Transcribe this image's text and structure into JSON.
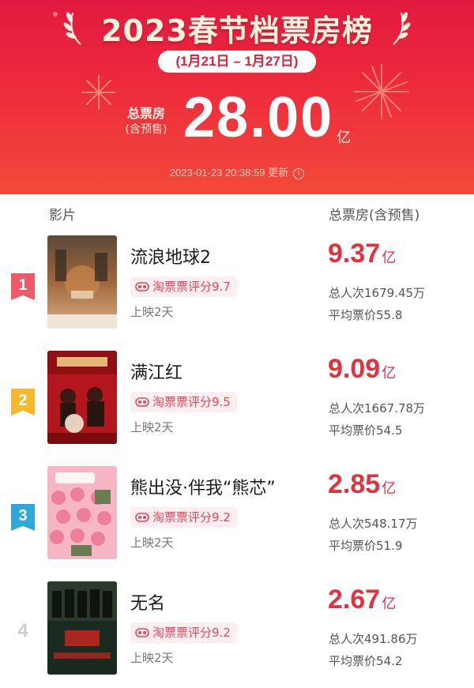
{
  "header": {
    "title": "2023春节档票房榜",
    "date_range": "(1月21日 – 1月27日)",
    "total_label_line1": "总票房",
    "total_label_line2": "(含预售)",
    "total_value": "28.00",
    "total_unit": "亿",
    "updated": "2023-01-23 20:38:59 更新",
    "info_icon": "info-icon"
  },
  "columns": {
    "film": "影片",
    "box_office": "总票房(含预售)"
  },
  "colors": {
    "header_red": "#e2193f",
    "accent_red": "#e2323f",
    "rank1": "#ef5a6a",
    "rank2": "#f4b92d",
    "rank3": "#2fa8d8"
  },
  "movies": [
    {
      "rank": "1",
      "title": "流浪地球2",
      "rating": "淘票票评分9.7",
      "days": "上映2天",
      "box_office": "9.37",
      "unit": "亿",
      "admissions": "总人次1679.45万",
      "avg_price": "平均票价55.8"
    },
    {
      "rank": "2",
      "title": "满江红",
      "rating": "淘票票评分9.5",
      "days": "上映2天",
      "box_office": "9.09",
      "unit": "亿",
      "admissions": "总人次1667.78万",
      "avg_price": "平均票价54.5"
    },
    {
      "rank": "3",
      "title": "熊出没·伴我“熊芯”",
      "rating": "淘票票评分9.2",
      "days": "上映2天",
      "box_office": "2.85",
      "unit": "亿",
      "admissions": "总人次548.17万",
      "avg_price": "平均票价51.9"
    },
    {
      "rank": "4",
      "title": "无名",
      "rating": "淘票票评分9.2",
      "days": "上映2天",
      "box_office": "2.67",
      "unit": "亿",
      "admissions": "总人次491.86万",
      "avg_price": "平均票价54.2"
    }
  ]
}
